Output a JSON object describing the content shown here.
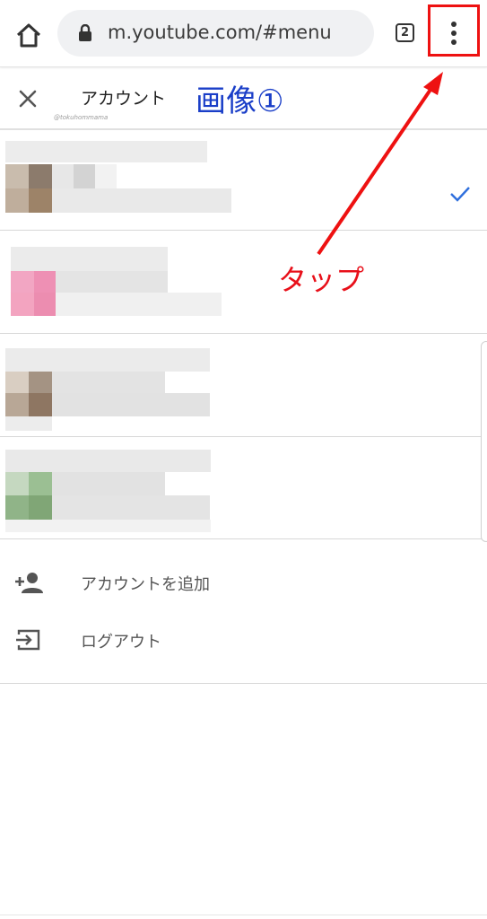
{
  "browser": {
    "url": "m.youtube.com/#menu",
    "tab_count": "2",
    "icons": {
      "home": "home-icon",
      "lock": "lock-icon",
      "menu": "more-vert-icon"
    }
  },
  "account_panel": {
    "title": "アカウント",
    "watermark": "@tokuhommama",
    "accounts": [
      {
        "selected": true
      },
      {
        "selected": false
      },
      {
        "selected": false
      },
      {
        "selected": false
      }
    ],
    "actions": [
      {
        "label": "アカウントを追加",
        "icon": "person-add-icon"
      },
      {
        "label": "ログアウト",
        "icon": "logout-icon"
      }
    ]
  },
  "annotations": {
    "image_label": "画像①",
    "tap_label": "タップ",
    "color_red": "#ee1111",
    "color_blue": "#1a3ec8"
  },
  "colors": {
    "check": "#2f6fdd"
  }
}
